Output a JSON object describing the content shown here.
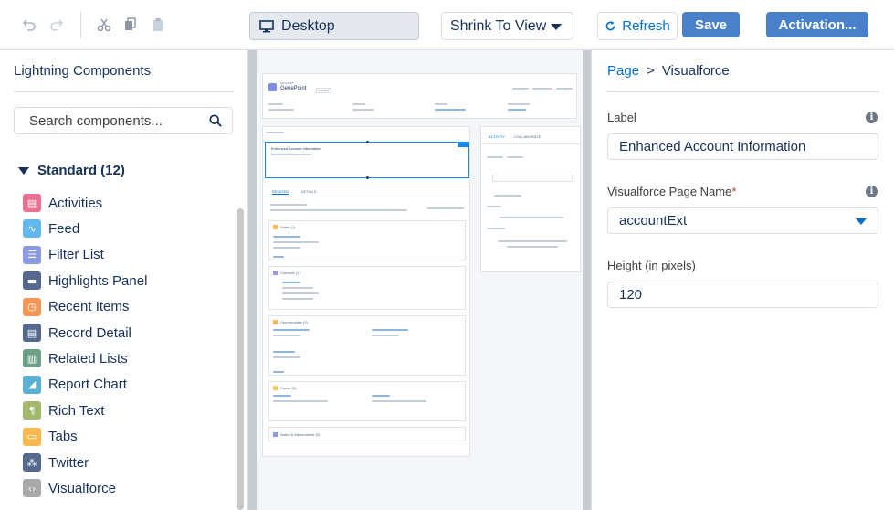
{
  "toolbar": {
    "device_label": "Desktop",
    "view_mode": "Shrink To View",
    "refresh_label": "Refresh",
    "save_label": "Save",
    "activation_label": "Activation..."
  },
  "sidebar": {
    "title": "Lightning Components",
    "search_placeholder": "Search components...",
    "section_label": "Standard (12)",
    "components": [
      {
        "label": "Activities",
        "icon": "activities-icon",
        "color": "#eb7092"
      },
      {
        "label": "Feed",
        "icon": "feed-icon",
        "color": "#62b7ed"
      },
      {
        "label": "Filter List",
        "icon": "filter-list-icon",
        "color": "#8b9ae3"
      },
      {
        "label": "Highlights Panel",
        "icon": "highlights-panel-icon",
        "color": "#54698d"
      },
      {
        "label": "Recent Items",
        "icon": "recent-items-icon",
        "color": "#f49756"
      },
      {
        "label": "Record Detail",
        "icon": "record-detail-icon",
        "color": "#54698d"
      },
      {
        "label": "Related Lists",
        "icon": "related-lists-icon",
        "color": "#6ca188"
      },
      {
        "label": "Report Chart",
        "icon": "report-chart-icon",
        "color": "#5ab0d2"
      },
      {
        "label": "Rich Text",
        "icon": "rich-text-icon",
        "color": "#a1b86d"
      },
      {
        "label": "Tabs",
        "icon": "tabs-icon",
        "color": "#f7b94e"
      },
      {
        "label": "Twitter",
        "icon": "twitter-icon",
        "color": "#54698d"
      },
      {
        "label": "Visualforce",
        "icon": "visualforce-icon",
        "color": "#a8a8a8"
      }
    ]
  },
  "preview": {
    "account_label": "ACCOUNT",
    "account_name": "GenePoint",
    "follow_label": "+ Follow",
    "vf_title": "Enhanced Account Information",
    "tabs": [
      "RELATED",
      "DETAILS"
    ],
    "activity_tabs": [
      "ACTIVITY",
      "COLLABORATE"
    ],
    "related": [
      {
        "title": "Notes (1)"
      },
      {
        "title": "Contacts (1)"
      },
      {
        "title": "Opportunities (3)"
      },
      {
        "title": "Cases (2)"
      },
      {
        "title": "Notes & Attachments (0)"
      }
    ]
  },
  "properties": {
    "breadcrumb_root": "Page",
    "breadcrumb_sep": ">",
    "breadcrumb_current": "Visualforce",
    "label_label": "Label",
    "label_value": "Enhanced Account Information",
    "vf_page_name_label": "Visualforce Page Name",
    "required_mark": "*",
    "vf_page_name_value": "accountExt",
    "height_label": "Height (in pixels)",
    "height_value": "120"
  }
}
